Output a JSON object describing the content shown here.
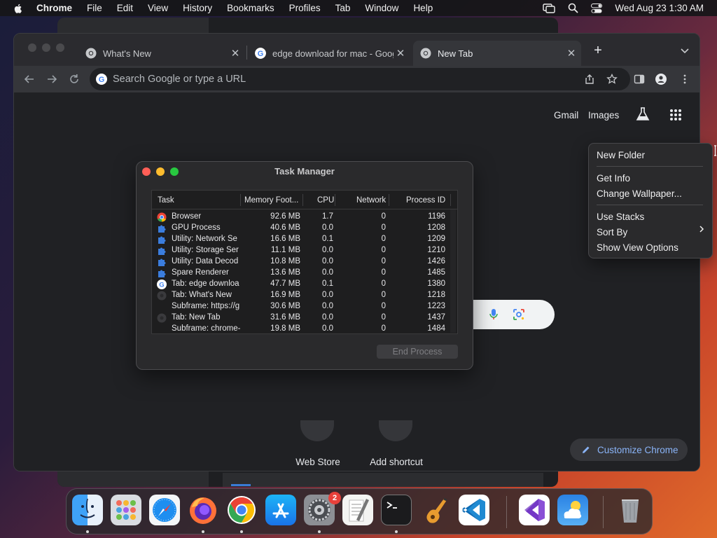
{
  "menubar": {
    "items": [
      "Chrome",
      "File",
      "Edit",
      "View",
      "History",
      "Bookmarks",
      "Profiles",
      "Tab",
      "Window",
      "Help"
    ],
    "datetime": "Wed Aug 23  1:30 AM"
  },
  "chrome": {
    "tabs": [
      {
        "title": "What's New",
        "icon": "chrome-icon",
        "active": false
      },
      {
        "title": "edge download for mac - Google Search",
        "icon": "google-icon",
        "active": false
      },
      {
        "title": "New Tab",
        "icon": "chrome-icon",
        "active": true
      }
    ],
    "omnibox_placeholder": "Search Google or type a URL",
    "newtab_links": {
      "gmail": "Gmail",
      "images": "Images"
    },
    "shortcuts": [
      "Web Store",
      "Add shortcut"
    ],
    "customize_label": "Customize Chrome"
  },
  "task_manager": {
    "title": "Task Manager",
    "columns": [
      "Task",
      "Memory Foot...",
      "CPU",
      "Network",
      "Process ID"
    ],
    "rows": [
      {
        "icon": "chrome",
        "task": "Browser",
        "memory": "92.6 MB",
        "cpu": "1.7",
        "network": "0",
        "pid": "1196"
      },
      {
        "icon": "puzzle",
        "task": "GPU Process",
        "memory": "40.6 MB",
        "cpu": "0.0",
        "network": "0",
        "pid": "1208"
      },
      {
        "icon": "puzzle",
        "task": "Utility: Network Se",
        "memory": "16.6 MB",
        "cpu": "0.1",
        "network": "0",
        "pid": "1209"
      },
      {
        "icon": "puzzle",
        "task": "Utility: Storage Ser",
        "memory": "11.1 MB",
        "cpu": "0.0",
        "network": "0",
        "pid": "1210"
      },
      {
        "icon": "puzzle",
        "task": "Utility: Data Decod",
        "memory": "10.8 MB",
        "cpu": "0.0",
        "network": "0",
        "pid": "1426"
      },
      {
        "icon": "puzzle",
        "task": "Spare Renderer",
        "memory": "13.6 MB",
        "cpu": "0.0",
        "network": "0",
        "pid": "1485"
      },
      {
        "icon": "google",
        "task": "Tab: edge downloa",
        "memory": "47.7 MB",
        "cpu": "0.1",
        "network": "0",
        "pid": "1380"
      },
      {
        "icon": "chrome-dim",
        "task": "Tab: What's New",
        "memory": "16.9 MB",
        "cpu": "0.0",
        "network": "0",
        "pid": "1218"
      },
      {
        "icon": "none",
        "task": "Subframe: https://g",
        "memory": "30.6 MB",
        "cpu": "0.0",
        "network": "0",
        "pid": "1223"
      },
      {
        "icon": "chrome-dim",
        "task": "Tab: New Tab",
        "memory": "31.6 MB",
        "cpu": "0.0",
        "network": "0",
        "pid": "1437"
      },
      {
        "icon": "none",
        "task": "Subframe: chrome-",
        "memory": "19.8 MB",
        "cpu": "0.0",
        "network": "0",
        "pid": "1484"
      }
    ],
    "end_process_label": "End Process"
  },
  "context_menu": {
    "items": [
      "New Folder",
      "Get Info",
      "Change Wallpaper...",
      "Use Stacks",
      "Sort By",
      "Show View Options"
    ]
  },
  "dock": {
    "apps": [
      "finder",
      "launchpad",
      "safari",
      "firefox",
      "chrome",
      "app-store",
      "system-settings",
      "textedit",
      "terminal",
      "garageband",
      "vscode",
      "visual-studio",
      "weather",
      "trash"
    ],
    "settings_badge": "2"
  }
}
